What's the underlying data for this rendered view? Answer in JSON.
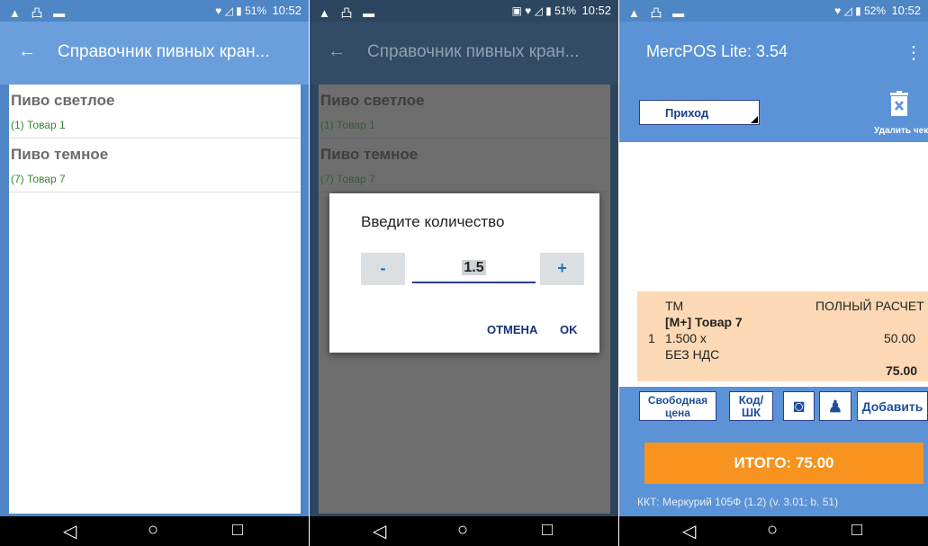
{
  "status_left": "▲ 凸 ▬",
  "screen1": {
    "status": {
      "icons": "♥ ◿ ▮",
      "battery": "51%",
      "time": "10:52"
    },
    "appbar": {
      "back": "←",
      "title": "Справочник пивных кран..."
    },
    "groups": [
      {
        "title": "Пиво светлое",
        "item": "(1) Товар 1"
      },
      {
        "title": "Пиво темное",
        "item": "(7) Товар 7"
      }
    ]
  },
  "screen2": {
    "status": {
      "icons": "▣ ♥ ◿ ▮",
      "battery": "51%",
      "time": "10:52"
    },
    "appbar": {
      "back": "←",
      "title": "Справочник пивных кран..."
    },
    "groups": [
      {
        "title": "Пиво светлое",
        "item": "(1) Товар 1"
      },
      {
        "title": "Пиво темное",
        "item": "(7) Товар 7"
      }
    ],
    "dialog": {
      "title": "Введите количество",
      "minus": "-",
      "plus": "+",
      "value": "1.5",
      "cancel": "ОТМЕНА",
      "ok": "OK"
    }
  },
  "screen3": {
    "status": {
      "icons": "♥ ◿ ▮",
      "battery": "52%",
      "time": "10:52"
    },
    "appbar": {
      "title": "MercPOS Lite: 3.54",
      "menu": "⋮"
    },
    "doc_type": "Приход",
    "delete_label": "Удалить чек",
    "receipt": {
      "tm": "ТМ",
      "mode": "ПОЛНЫЙ РАСЧЕТ",
      "name": "[М+] Товар 7",
      "num": "1",
      "qty": "1.500 x",
      "price": "50.00",
      "vat": "БЕЗ НДС",
      "total": "75.00"
    },
    "buttons": {
      "free_price_1": "Свободная",
      "free_price_2": "цена",
      "code_1": "Код/",
      "code_2": "ШК",
      "add": "Добавить"
    },
    "total_button": "ИТОГО: 75.00",
    "kkt": "ККТ: Меркурий 105Ф (1.2) (v. 3.01; b. 51)"
  },
  "nav": {
    "back": "◁",
    "home": "○",
    "recent": "□"
  },
  "colors": {
    "appbar": "#6a9fdc",
    "item_green": "#2e8b2e",
    "total_orange": "#f7931e",
    "receipt_bg": "#fcd9b4"
  }
}
